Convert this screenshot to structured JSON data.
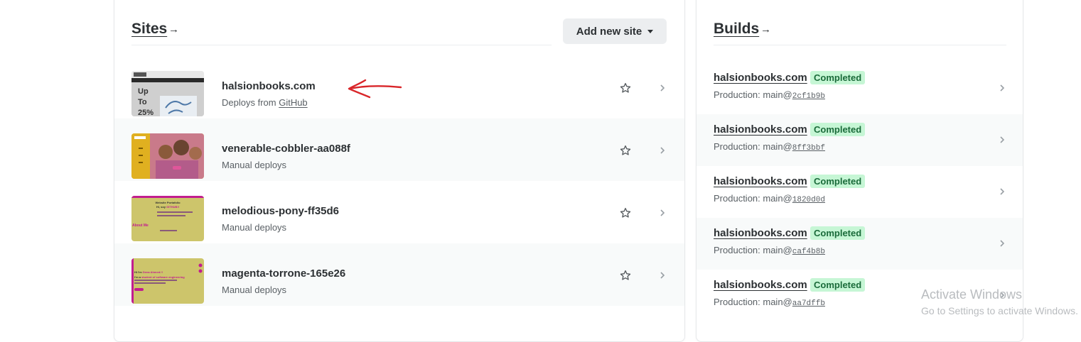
{
  "sites": {
    "title": "Sites",
    "title_arrow": "→",
    "add_button_label": "Add new site",
    "items": [
      {
        "name": "halsionbooks.com",
        "deploy_prefix": "Deploys from ",
        "deploy_link": "GitHub"
      },
      {
        "name": "venerable-cobbler-aa088f",
        "deploy_text": "Manual deploys"
      },
      {
        "name": "melodious-pony-ff35d6",
        "deploy_text": "Manual deploys"
      },
      {
        "name": "magenta-torrone-165e26",
        "deploy_text": "Manual deploys"
      }
    ],
    "thumbnails": {
      "t1": {
        "line1": "Up",
        "line2": "To",
        "line3": "25%"
      },
      "t3": {
        "heading": "Website Portafolio",
        "sub": "Hi, soy ",
        "name": "GITHUB!!",
        "about": "About Me"
      },
      "t4": {
        "line1": "Hi I'm ",
        "name": "Dena Ahmed.!!",
        "line2": "I'm a ",
        "role": "student of software engineering"
      }
    }
  },
  "builds": {
    "title": "Builds",
    "title_arrow": "→",
    "items": [
      {
        "site": "halsionbooks.com",
        "status": "Completed",
        "context": "Production: main@",
        "commit": "2cf1b9b"
      },
      {
        "site": "halsionbooks.com",
        "status": "Completed",
        "context": "Production: main@",
        "commit": "8ff3bbf"
      },
      {
        "site": "halsionbooks.com",
        "status": "Completed",
        "context": "Production: main@",
        "commit": "1820d0d"
      },
      {
        "site": "halsionbooks.com",
        "status": "Completed",
        "context": "Production: main@",
        "commit": "caf4b8b"
      },
      {
        "site": "halsionbooks.com",
        "status": "Completed",
        "context": "Production: main@",
        "commit": "aa7dffb"
      }
    ]
  },
  "watermark": {
    "line1": "Activate Windows",
    "line2": "Go to Settings to activate Windows."
  },
  "colors": {
    "badge_bg": "#c6f6d5",
    "badge_text": "#1a6b3a",
    "annotation_arrow": "#d9262a"
  }
}
